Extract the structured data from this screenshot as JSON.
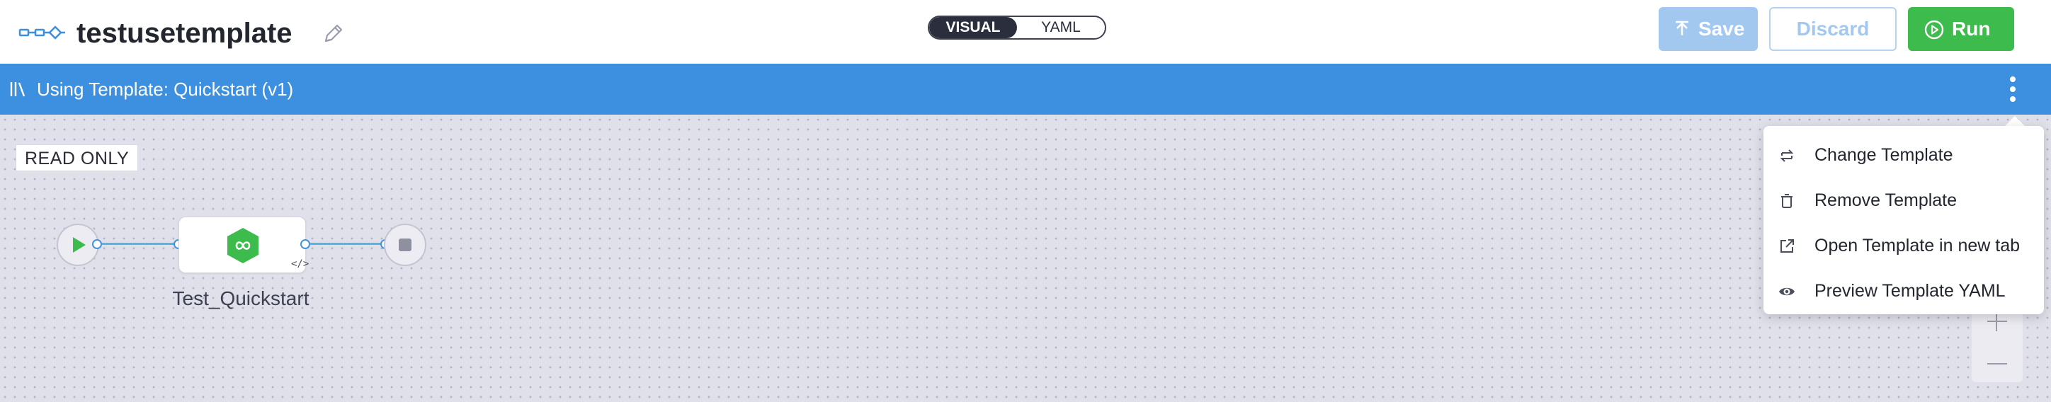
{
  "header": {
    "pipeline_name": "testusetemplate",
    "view_toggle": {
      "visual_label": "VISUAL",
      "yaml_label": "YAML",
      "selected": "VISUAL"
    },
    "save_label": "Save",
    "discard_label": "Discard",
    "run_label": "Run"
  },
  "template_bar": {
    "text": "Using Template: Quickstart (v1)"
  },
  "canvas": {
    "read_only_label": "READ ONLY",
    "stage_name": "Test_Quickstart"
  },
  "menu": {
    "items": [
      {
        "label": "Change Template",
        "icon": "swap-icon"
      },
      {
        "label": "Remove Template",
        "icon": "trash-icon"
      },
      {
        "label": "Open Template in new tab",
        "icon": "external-link-icon"
      },
      {
        "label": "Preview Template YAML",
        "icon": "eye-icon"
      }
    ]
  },
  "colors": {
    "brand_blue": "#3d8fdf",
    "run_green": "#3dbb4c",
    "save_disabled": "#a3c8ef",
    "stage_icon_green": "#3dbb4c"
  }
}
